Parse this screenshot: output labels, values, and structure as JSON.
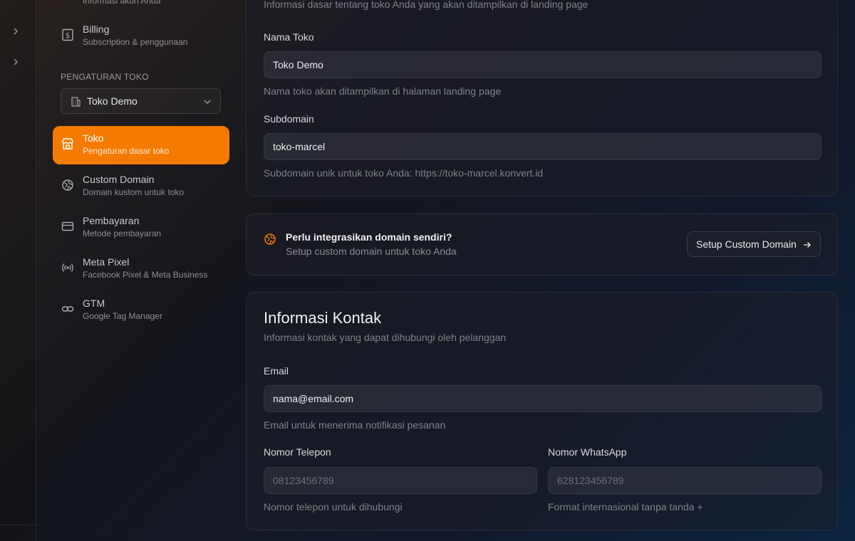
{
  "sidebar": {
    "account_sub_cut": "Informasi akun Anda",
    "billing": {
      "title": "Billing",
      "subtitle": "Subscription & penggunaan"
    },
    "section_label": "PENGATURAN TOKO",
    "store_selector": {
      "value": "Toko Demo"
    },
    "items": [
      {
        "title": "Toko",
        "subtitle": "Pengaturan dasar toko",
        "icon": "store-icon"
      },
      {
        "title": "Custom Domain",
        "subtitle": "Domain kustom untuk toko",
        "icon": "globe-icon"
      },
      {
        "title": "Pembayaran",
        "subtitle": "Metode pembayaran",
        "icon": "credit-card-icon"
      },
      {
        "title": "Meta Pixel",
        "subtitle": "Facebook Pixel & Meta Business",
        "icon": "broadcast-icon"
      },
      {
        "title": "GTM",
        "subtitle": "Google Tag Manager",
        "icon": "link-icon"
      }
    ]
  },
  "store_info": {
    "description_cut": "Informasi dasar tentang toko Anda yang akan ditampilkan di landing page",
    "name_label": "Nama Toko",
    "name_value": "Toko Demo",
    "name_help": "Nama toko akan ditampilkan di halaman landing page",
    "subdomain_label": "Subdomain",
    "subdomain_value": "toko-marcel",
    "subdomain_help": "Subdomain unik untuk toko Anda: https://toko-marcel.konvert.id"
  },
  "domain_callout": {
    "title": "Perlu integrasikan domain sendiri?",
    "subtitle": "Setup custom domain untuk toko Anda",
    "button_label": "Setup Custom Domain"
  },
  "contact": {
    "title": "Informasi Kontak",
    "description": "Informasi kontak yang dapat dihubungi oleh pelanggan",
    "email_label": "Email",
    "email_value": "nama@email.com",
    "email_help": "Email untuk menerima notifikasi pesanan",
    "phone_label": "Nomor Telepon",
    "phone_placeholder": "08123456789",
    "phone_help": "Nomor telepon untuk dihubungi",
    "whatsapp_label": "Nomor WhatsApp",
    "whatsapp_placeholder": "628123456789",
    "whatsapp_help": "Format internasional tanpa tanda +"
  },
  "colors": {
    "accent": "#f57a00"
  }
}
